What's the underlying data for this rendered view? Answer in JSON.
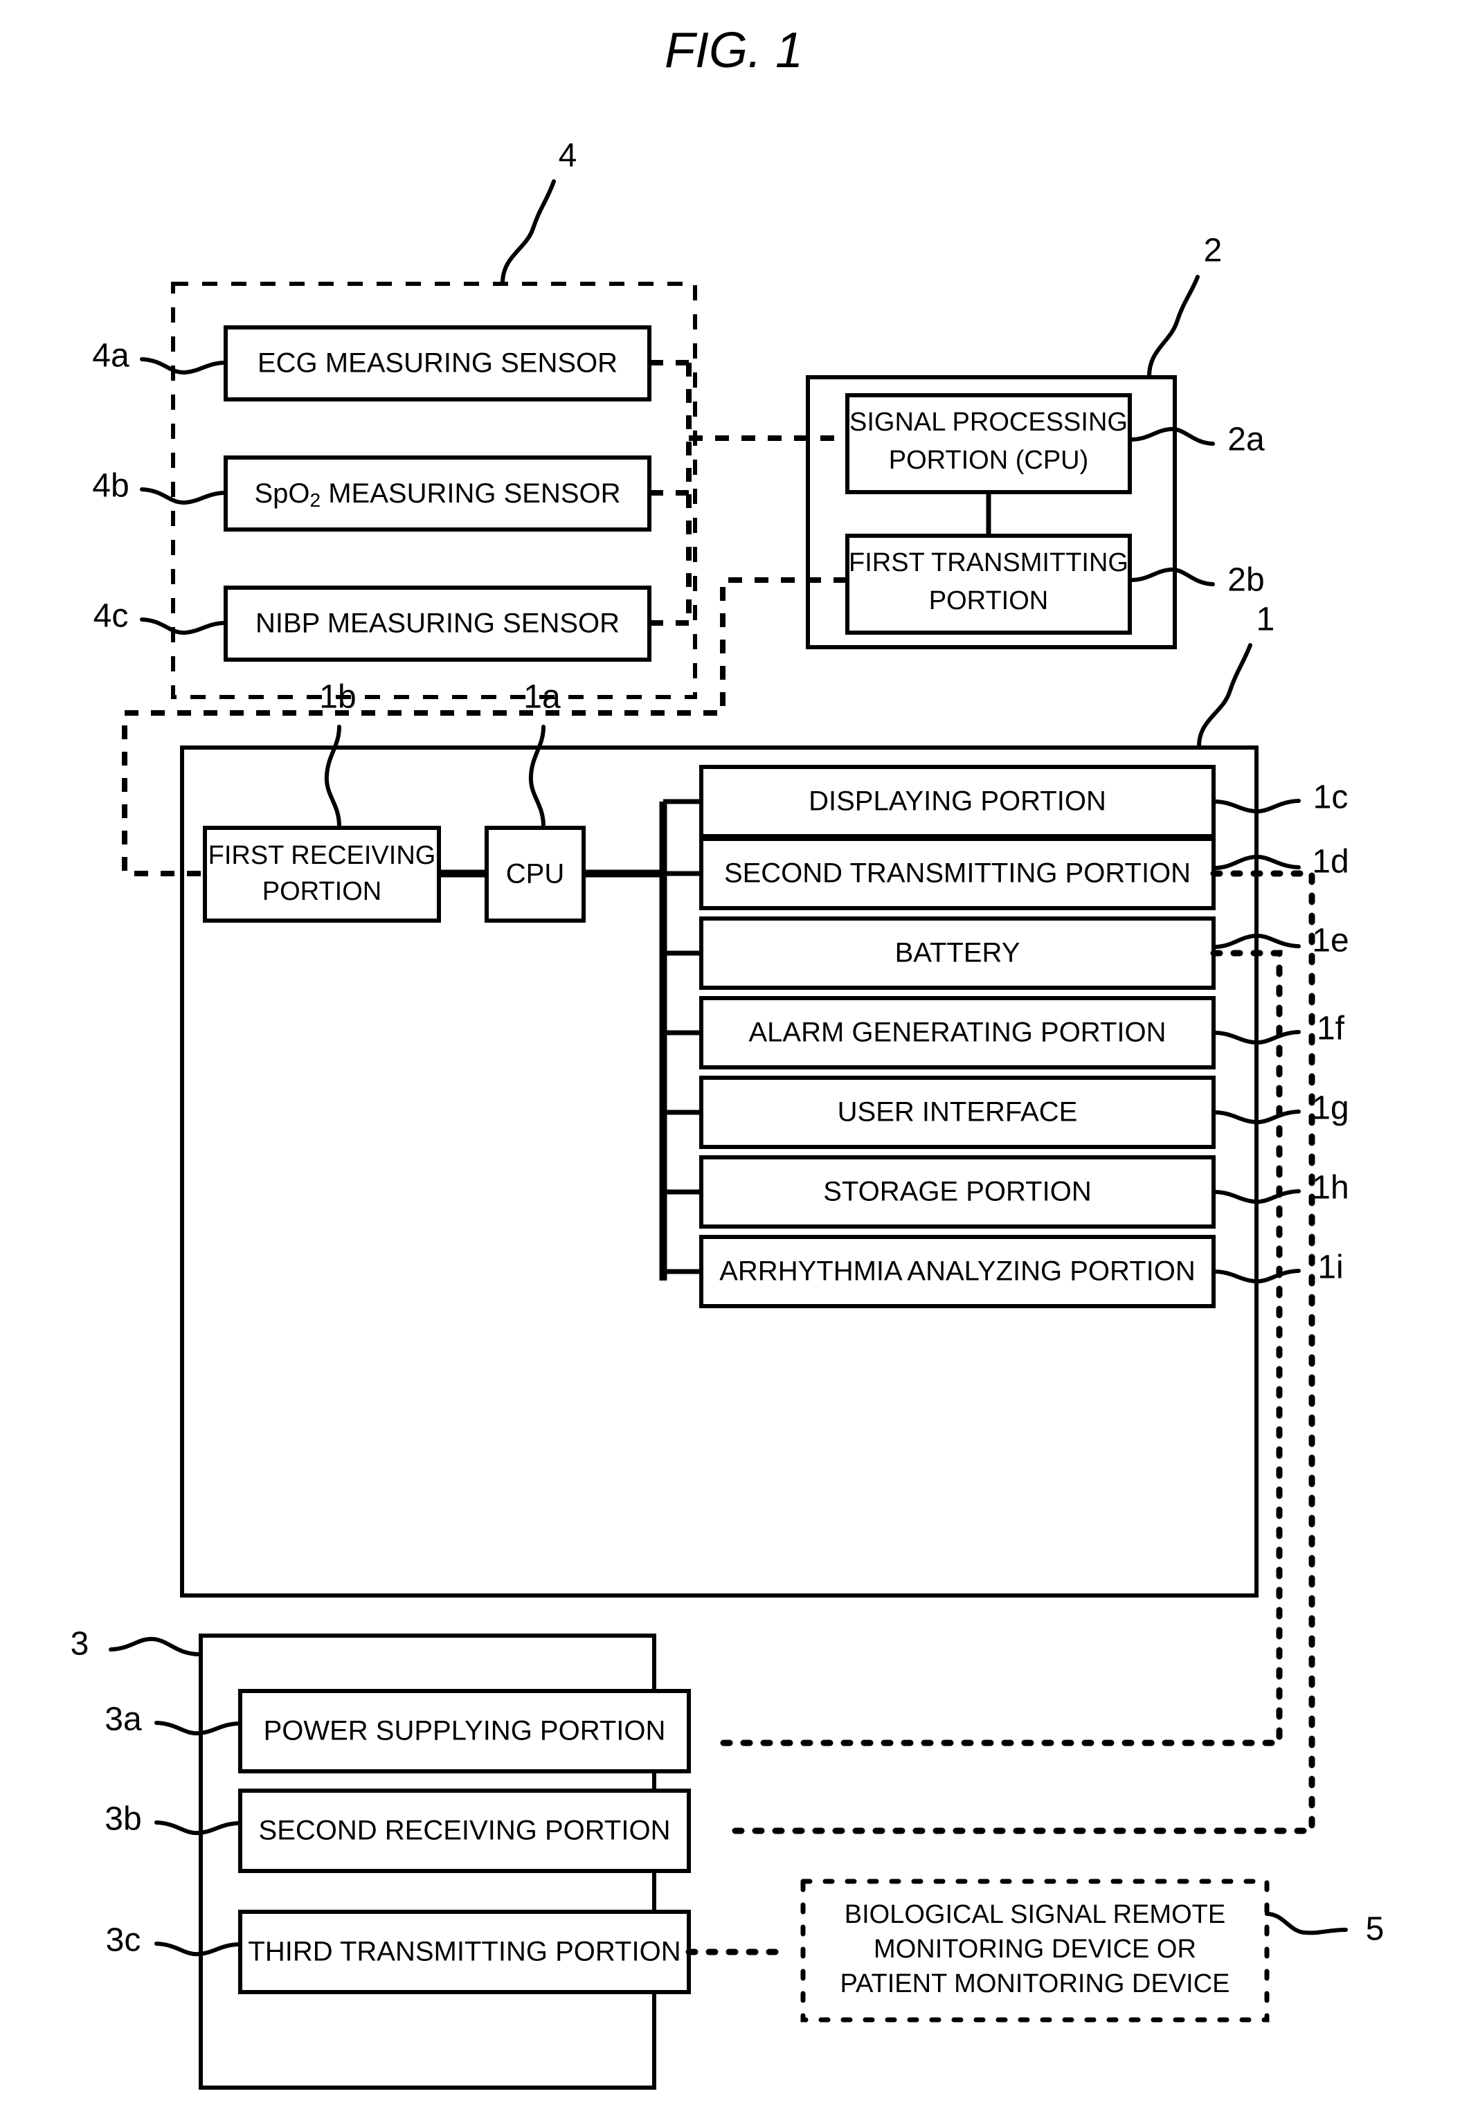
{
  "figure": {
    "title": "FIG. 1",
    "caption_ref": "FIG. 1"
  },
  "blocks": {
    "sensor_group": {
      "ref": "4",
      "items": [
        {
          "ref": "4a",
          "label": "ECG MEASURING SENSOR"
        },
        {
          "ref": "4b",
          "label_prefix": "SpO",
          "label_sub": "2",
          "label_suffix": " MEASURING SENSOR",
          "label": "SpO2 MEASURING SENSOR"
        },
        {
          "ref": "4c",
          "label": "NIBP MEASURING SENSOR"
        }
      ]
    },
    "transmitter_unit": {
      "ref": "2",
      "items": [
        {
          "ref": "2a",
          "label_line1": "SIGNAL PROCESSING",
          "label_line2": "PORTION (CPU)",
          "label": "SIGNAL PROCESSING PORTION (CPU)"
        },
        {
          "ref": "2b",
          "label_line1": "FIRST TRANSMITTING",
          "label_line2": "PORTION",
          "label": "FIRST TRANSMITTING PORTION"
        }
      ]
    },
    "main_unit": {
      "ref": "1",
      "receiving": {
        "ref": "1b",
        "label_line1": "FIRST RECEIVING",
        "label_line2": "PORTION",
        "label": "FIRST RECEIVING PORTION"
      },
      "cpu": {
        "ref": "1a",
        "label": "CPU"
      },
      "items": [
        {
          "ref": "1c",
          "label": "DISPLAYING PORTION"
        },
        {
          "ref": "1d",
          "label": "SECOND TRANSMITTING PORTION"
        },
        {
          "ref": "1e",
          "label": "BATTERY"
        },
        {
          "ref": "1f",
          "label": "ALARM GENERATING PORTION"
        },
        {
          "ref": "1g",
          "label": "USER INTERFACE"
        },
        {
          "ref": "1h",
          "label": "STORAGE PORTION"
        },
        {
          "ref": "1i",
          "label": "ARRHYTHMIA ANALYZING PORTION"
        }
      ]
    },
    "cradle_unit": {
      "ref": "3",
      "items": [
        {
          "ref": "3a",
          "label": "POWER SUPPLYING PORTION"
        },
        {
          "ref": "3b",
          "label": "SECOND RECEIVING PORTION"
        },
        {
          "ref": "3c",
          "label": "THIRD TRANSMITTING PORTION"
        }
      ]
    },
    "remote_device": {
      "ref": "5",
      "label_line1": "BIOLOGICAL SIGNAL REMOTE",
      "label_line2": "MONITORING DEVICE OR",
      "label_line3": "PATIENT MONITORING DEVICE",
      "label": "BIOLOGICAL SIGNAL REMOTE MONITORING DEVICE OR PATIENT MONITORING DEVICE"
    }
  },
  "colors": {
    "ink": "#000000",
    "paper": "#ffffff"
  }
}
